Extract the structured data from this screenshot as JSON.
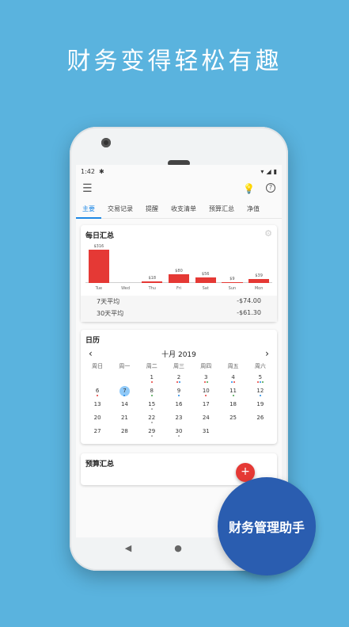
{
  "headline": "财务变得轻松有趣",
  "status": {
    "time": "1:42"
  },
  "tabs": [
    {
      "label": "主要"
    },
    {
      "label": "交易记录"
    },
    {
      "label": "提醒"
    },
    {
      "label": "收支清单"
    },
    {
      "label": "预算汇总"
    },
    {
      "label": "净值"
    }
  ],
  "daily": {
    "title": "每日汇总",
    "avg7_label": "7天平均",
    "avg7_value": "-$74.00",
    "avg30_label": "30天平均",
    "avg30_value": "-$61.30"
  },
  "chart_data": {
    "type": "bar",
    "title": "每日汇总",
    "categories": [
      "Tue",
      "Wed",
      "Thu",
      "Fri",
      "Sat",
      "Sun",
      "Mon"
    ],
    "values": [
      316,
      0,
      18,
      80,
      56,
      9,
      39
    ],
    "data_labels": [
      "$316",
      "",
      "$18",
      "$80",
      "$56",
      "$9",
      "$39"
    ],
    "ylim": [
      0,
      330
    ],
    "color": "#e53935"
  },
  "calendar": {
    "title": "日历",
    "month": "十月 2019",
    "prev": "‹",
    "next": "›",
    "weekdays": [
      "周日",
      "周一",
      "周二",
      "周三",
      "周四",
      "周五",
      "周六"
    ],
    "weeks": [
      [
        "",
        "",
        "1",
        "2",
        "3",
        "4",
        "5"
      ],
      [
        "6",
        "7",
        "8",
        "9",
        "10",
        "11",
        "12"
      ],
      [
        "13",
        "14",
        "15",
        "16",
        "17",
        "18",
        "19"
      ],
      [
        "20",
        "21",
        "22",
        "23",
        "24",
        "25",
        "26"
      ],
      [
        "27",
        "28",
        "29",
        "30",
        "31",
        "",
        ""
      ]
    ],
    "today": "7"
  },
  "budget": {
    "title": "预算汇总"
  },
  "fab": {
    "label": "+"
  },
  "badge": {
    "label": "财务管理助手"
  },
  "colors": {
    "background": "#5ab3de",
    "accent": "#1e88e5",
    "bar": "#e53935",
    "badge": "#2a5db0"
  }
}
